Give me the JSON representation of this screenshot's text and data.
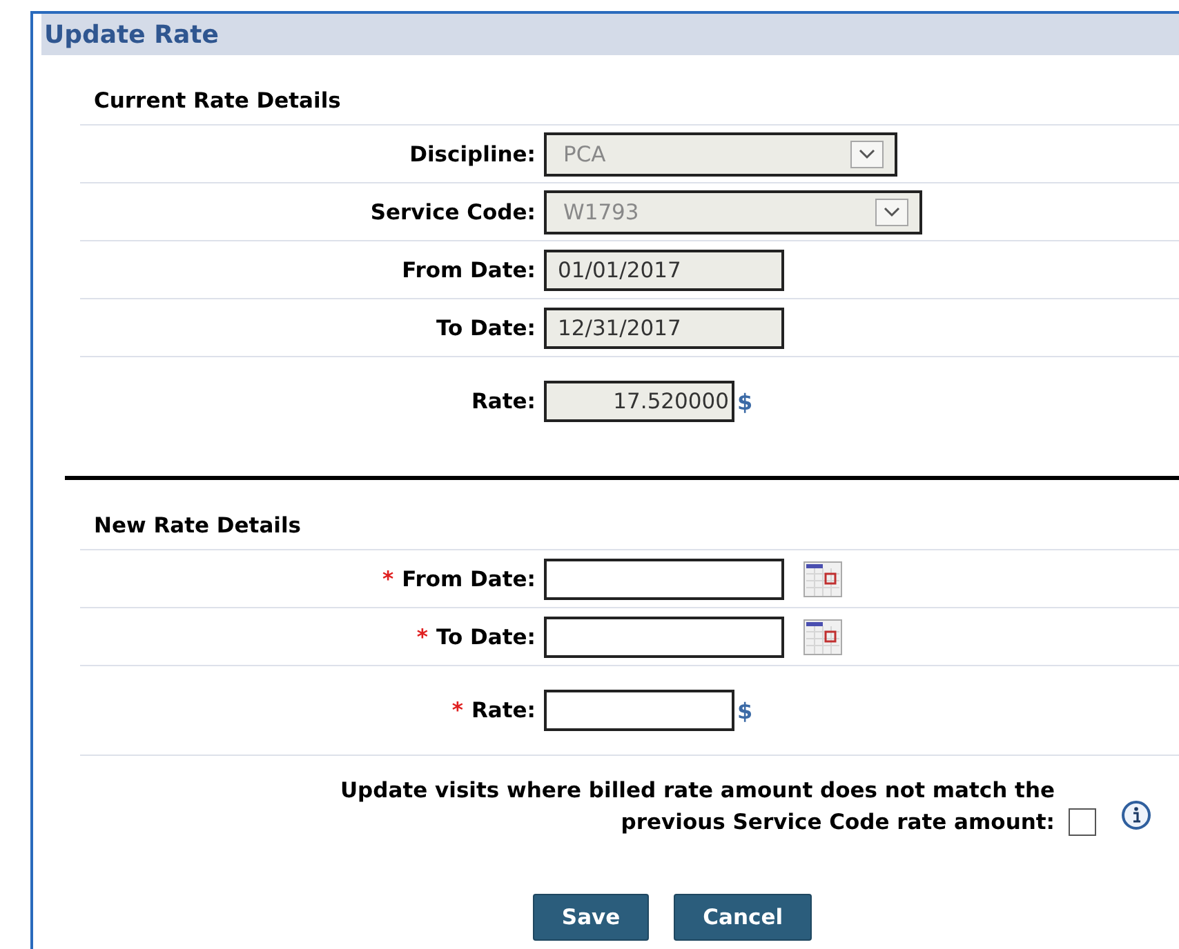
{
  "panel": {
    "title": "Update Rate"
  },
  "sections": [
    {
      "heading": "Current Rate Details",
      "fields": [
        {
          "kind": "select",
          "label": "Discipline:",
          "value": "PCA",
          "disabled": true
        },
        {
          "kind": "select",
          "label": "Service Code:",
          "value": "W1793",
          "disabled": true
        },
        {
          "kind": "date",
          "label": "From Date:",
          "value": "01/01/2017",
          "disabled": true
        },
        {
          "kind": "date",
          "label": "To Date:",
          "value": "12/31/2017",
          "disabled": true
        },
        {
          "kind": "currency",
          "label": "Rate:",
          "value": "17.520000",
          "suffix": "$",
          "disabled": true
        }
      ]
    },
    {
      "heading": "New Rate Details",
      "fields": [
        {
          "kind": "datepicker",
          "label": "From Date:",
          "marker": "*",
          "disabled": false
        },
        {
          "kind": "datepicker",
          "label": "To Date:",
          "marker": "*",
          "disabled": false
        },
        {
          "kind": "currency",
          "label": "Rate:",
          "marker": "*",
          "suffix": "$",
          "disabled": false
        }
      ]
    }
  ],
  "update_option": {
    "label_line_1": "Update visits where billed rate amount does not match the",
    "label_line_2": "previous Service Code rate amount:",
    "checked": false
  },
  "buttons": [
    "Save",
    "Cancel"
  ]
}
